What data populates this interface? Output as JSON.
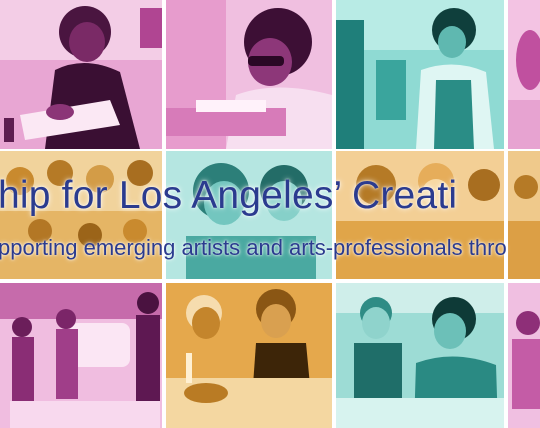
{
  "banner": {
    "headline": "hip for Los Angeles’ Creati",
    "subheadline": "pporting emerging artists and arts-professionals thro"
  },
  "colors": {
    "magenta_tint": "#c64aa6",
    "teal_tint": "#2fb7b0",
    "amber_tint": "#e2a13b",
    "title_blue": "#2b3b8f"
  },
  "tiles": [
    {
      "name": "photo-tile-young-man-writing",
      "tint": "magenta"
    },
    {
      "name": "photo-tile-man-with-glasses-on-laptop",
      "tint": "magenta"
    },
    {
      "name": "photo-tile-woman-talking",
      "tint": "teal"
    },
    {
      "name": "photo-tile-partial-right-top",
      "tint": "magenta"
    },
    {
      "name": "photo-tile-group-audience",
      "tint": "amber"
    },
    {
      "name": "photo-tile-two-people-smiling",
      "tint": "teal"
    },
    {
      "name": "photo-tile-people-laughing",
      "tint": "amber"
    },
    {
      "name": "photo-tile-partial-right-middle",
      "tint": "amber"
    },
    {
      "name": "photo-tile-outdoor-gathering",
      "tint": "magenta"
    },
    {
      "name": "photo-tile-people-at-table",
      "tint": "amber"
    },
    {
      "name": "photo-tile-women-at-desk",
      "tint": "teal"
    },
    {
      "name": "photo-tile-partial-right-bottom",
      "tint": "magenta"
    }
  ]
}
